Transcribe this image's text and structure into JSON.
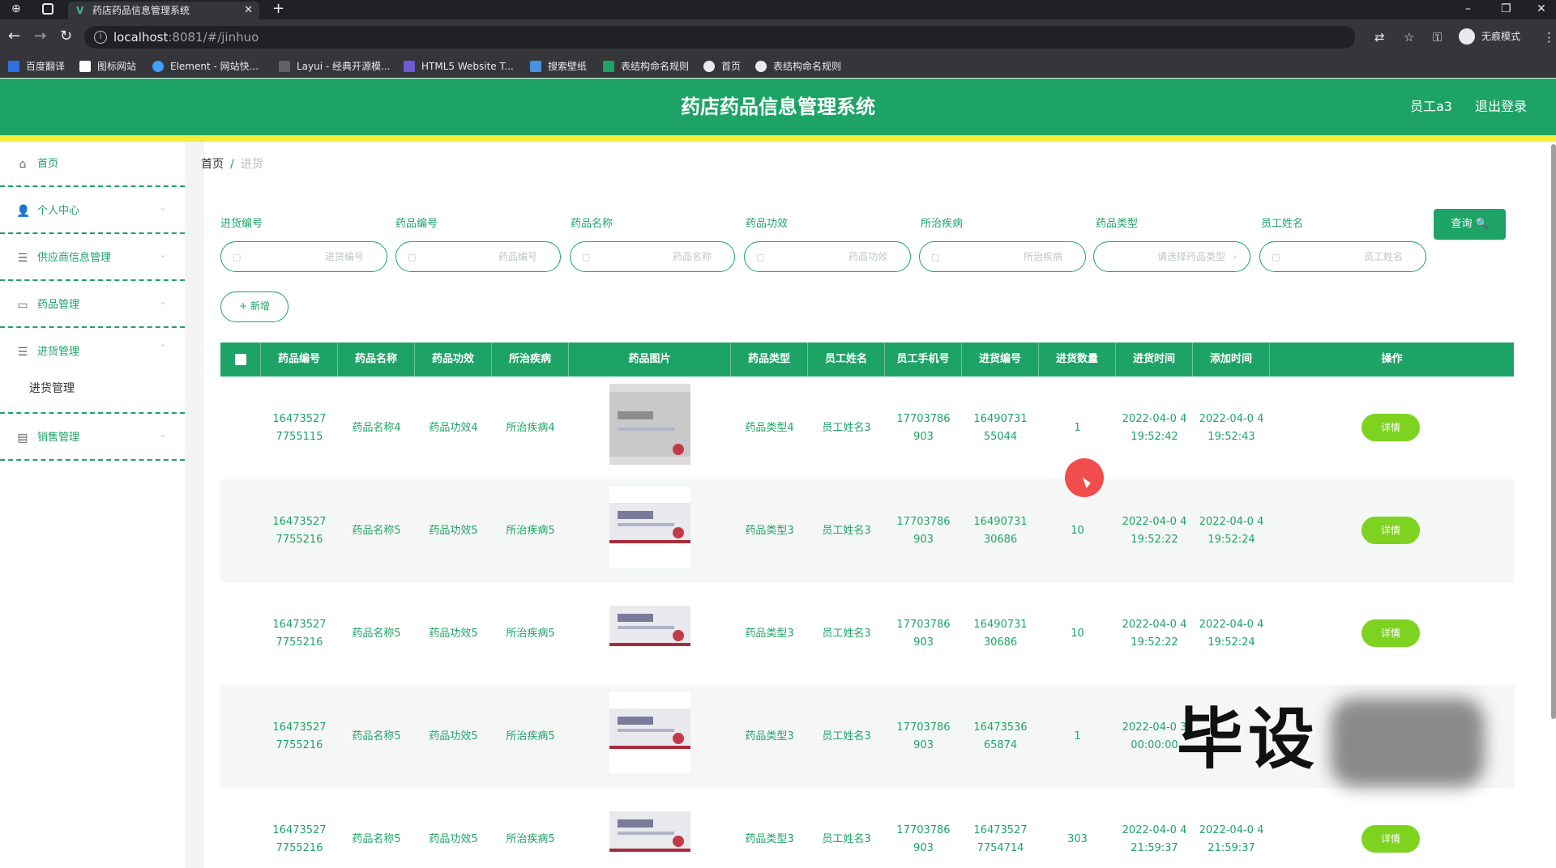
{
  "browser": {
    "tab_title": "药店药品信息管理系统",
    "tab_close": "✕",
    "new_tab": "+",
    "url_host": "localhost",
    "url_path": ":8081/#/jinhuo",
    "incognito_label": "无痕模式",
    "bookmarks": [
      {
        "label": "百度翻译",
        "color": "#2f6fe0"
      },
      {
        "label": "图标网站",
        "color": "#ffffff"
      },
      {
        "label": "Element - 网站快...",
        "color": "#409eff"
      },
      {
        "label": "Layui - 经典开源模...",
        "color": "#e8eaed"
      },
      {
        "label": "HTML5 Website T...",
        "color": "#6b5bd6"
      },
      {
        "label": "搜索壁纸",
        "color": "#4a90e2"
      },
      {
        "label": "表结构命名规则",
        "color": "#1ea366"
      },
      {
        "label": "首页",
        "color": "#e8eaed"
      },
      {
        "label": "表结构命名规则",
        "color": "#e8eaed"
      }
    ]
  },
  "header": {
    "title": "药店药品信息管理系统",
    "user": "员工a3",
    "logout": "退出登录",
    "color": "#1ea366",
    "stripe_color": "#f5ec3a"
  },
  "sidebar": {
    "items": [
      {
        "label": "首页",
        "icon": "home-icon"
      },
      {
        "label": "个人中心",
        "icon": "user-icon"
      },
      {
        "label": "供应商信息管理",
        "icon": "menu-icon"
      },
      {
        "label": "药品管理",
        "icon": "list-icon"
      },
      {
        "label": "进货管理",
        "icon": "menu-icon"
      },
      {
        "label": "销售管理",
        "icon": "chart-icon"
      }
    ],
    "sub_item": "进货管理"
  },
  "breadcrumb": {
    "home": "首页",
    "sep": "/",
    "current": "进货"
  },
  "filters": [
    {
      "label": "进货编号",
      "placeholder": "进货编号"
    },
    {
      "label": "药品编号",
      "placeholder": "药品编号"
    },
    {
      "label": "药品名称",
      "placeholder": "药品名称"
    },
    {
      "label": "药品功效",
      "placeholder": "药品功效"
    },
    {
      "label": "所治疾病",
      "placeholder": "所治疾病"
    },
    {
      "label": "药品类型",
      "placeholder": "请选择药品类型"
    },
    {
      "label": "员工姓名",
      "placeholder": "员工姓名"
    }
  ],
  "buttons": {
    "query": "查询 🔍",
    "add": "+ 新增",
    "detail": "详情"
  },
  "table": {
    "columns": [
      "药品编号",
      "药品名称",
      "药品功效",
      "所治疾病",
      "药品图片",
      "药品类型",
      "员工姓名",
      "员工手机号",
      "进货编号",
      "进货数量",
      "进货时间",
      "添加时间",
      "操作"
    ],
    "rows": [
      {
        "drug_no": "16473527 7755115",
        "name": "药品名称4",
        "effect": "药品功效4",
        "disease": "所治疾病4",
        "type": "药品类型4",
        "staff": "员工姓名3",
        "phone": "17703786 903",
        "purchase_no": "16490731 55044",
        "qty": "1",
        "purchase_time": "2022-04-0 4 19:52:42",
        "add_time": "2022-04-0 4 19:52:43"
      },
      {
        "drug_no": "16473527 7755216",
        "name": "药品名称5",
        "effect": "药品功效5",
        "disease": "所治疾病5",
        "type": "药品类型3",
        "staff": "员工姓名3",
        "phone": "17703786 903",
        "purchase_no": "16490731 30686",
        "qty": "10",
        "purchase_time": "2022-04-0 4 19:52:22",
        "add_time": "2022-04-0 4 19:52:24"
      },
      {
        "drug_no": "16473527 7755216",
        "name": "药品名称5",
        "effect": "药品功效5",
        "disease": "所治疾病5",
        "type": "药品类型3",
        "staff": "员工姓名3",
        "phone": "17703786 903",
        "purchase_no": "16490731 30686",
        "qty": "10",
        "purchase_time": "2022-04-0 4 19:52:22",
        "add_time": "2022-04-0 4 19:52:24"
      },
      {
        "drug_no": "16473527 7755216",
        "name": "药品名称5",
        "effect": "药品功效5",
        "disease": "所治疾病5",
        "type": "药品类型3",
        "staff": "员工姓名3",
        "phone": "17703786 903",
        "purchase_no": "16473536 65874",
        "qty": "1",
        "purchase_time": "2022-04-0 3 00:00:00",
        "add_time": ""
      },
      {
        "drug_no": "16473527 7755216",
        "name": "药品名称5",
        "effect": "药品功效5",
        "disease": "所治疾病5",
        "type": "药品类型3",
        "staff": "员工姓名3",
        "phone": "17703786 903",
        "purchase_no": "16473527 7754714",
        "qty": "303",
        "purchase_time": "2022-04-0 4 21:59:37",
        "add_time": "2022-04-0 4 21:59:37"
      }
    ]
  },
  "watermark": "毕设"
}
